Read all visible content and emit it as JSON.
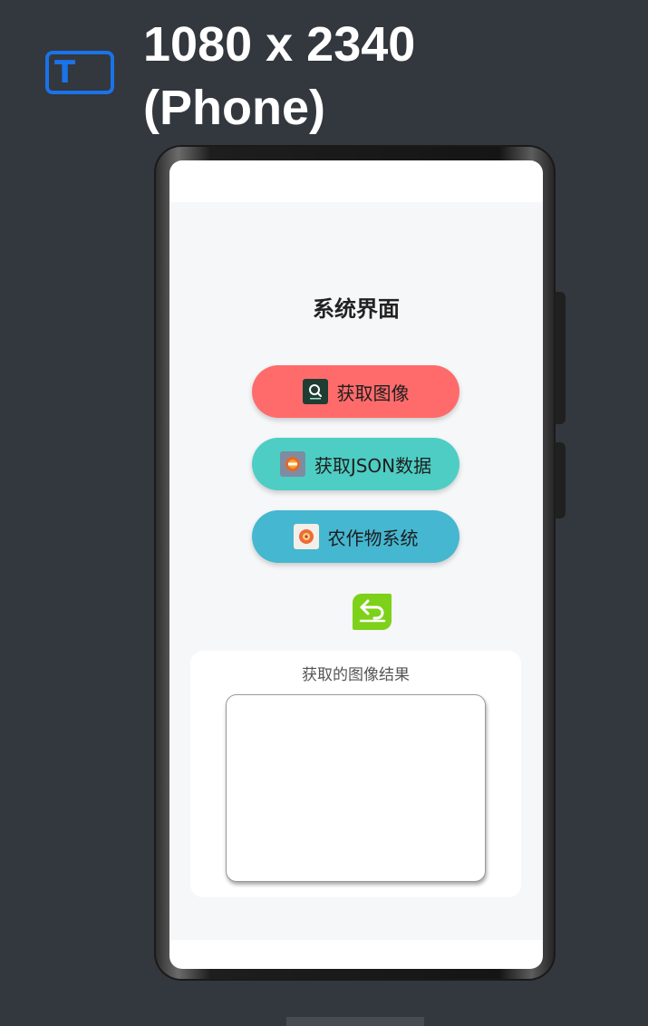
{
  "device": {
    "title": "1080 x 2340\n(Phone)",
    "icon_name": "tablet-text-icon",
    "icon_letter": "T",
    "accent_color": "#1a73e8"
  },
  "app": {
    "page_title": "系统界面",
    "buttons": [
      {
        "label": "获取图像",
        "icon": "image-search-icon",
        "color": "#ff6b6b"
      },
      {
        "label": "获取JSON数据",
        "icon": "json-badge-icon",
        "color": "#4ecdc4"
      },
      {
        "label": "农作物系统",
        "icon": "crop-flower-icon",
        "color": "#45b7d1"
      }
    ],
    "back_button": {
      "icon": "back-arrow-icon",
      "color": "#7dd119"
    },
    "result": {
      "label": "获取的图像结果"
    }
  }
}
